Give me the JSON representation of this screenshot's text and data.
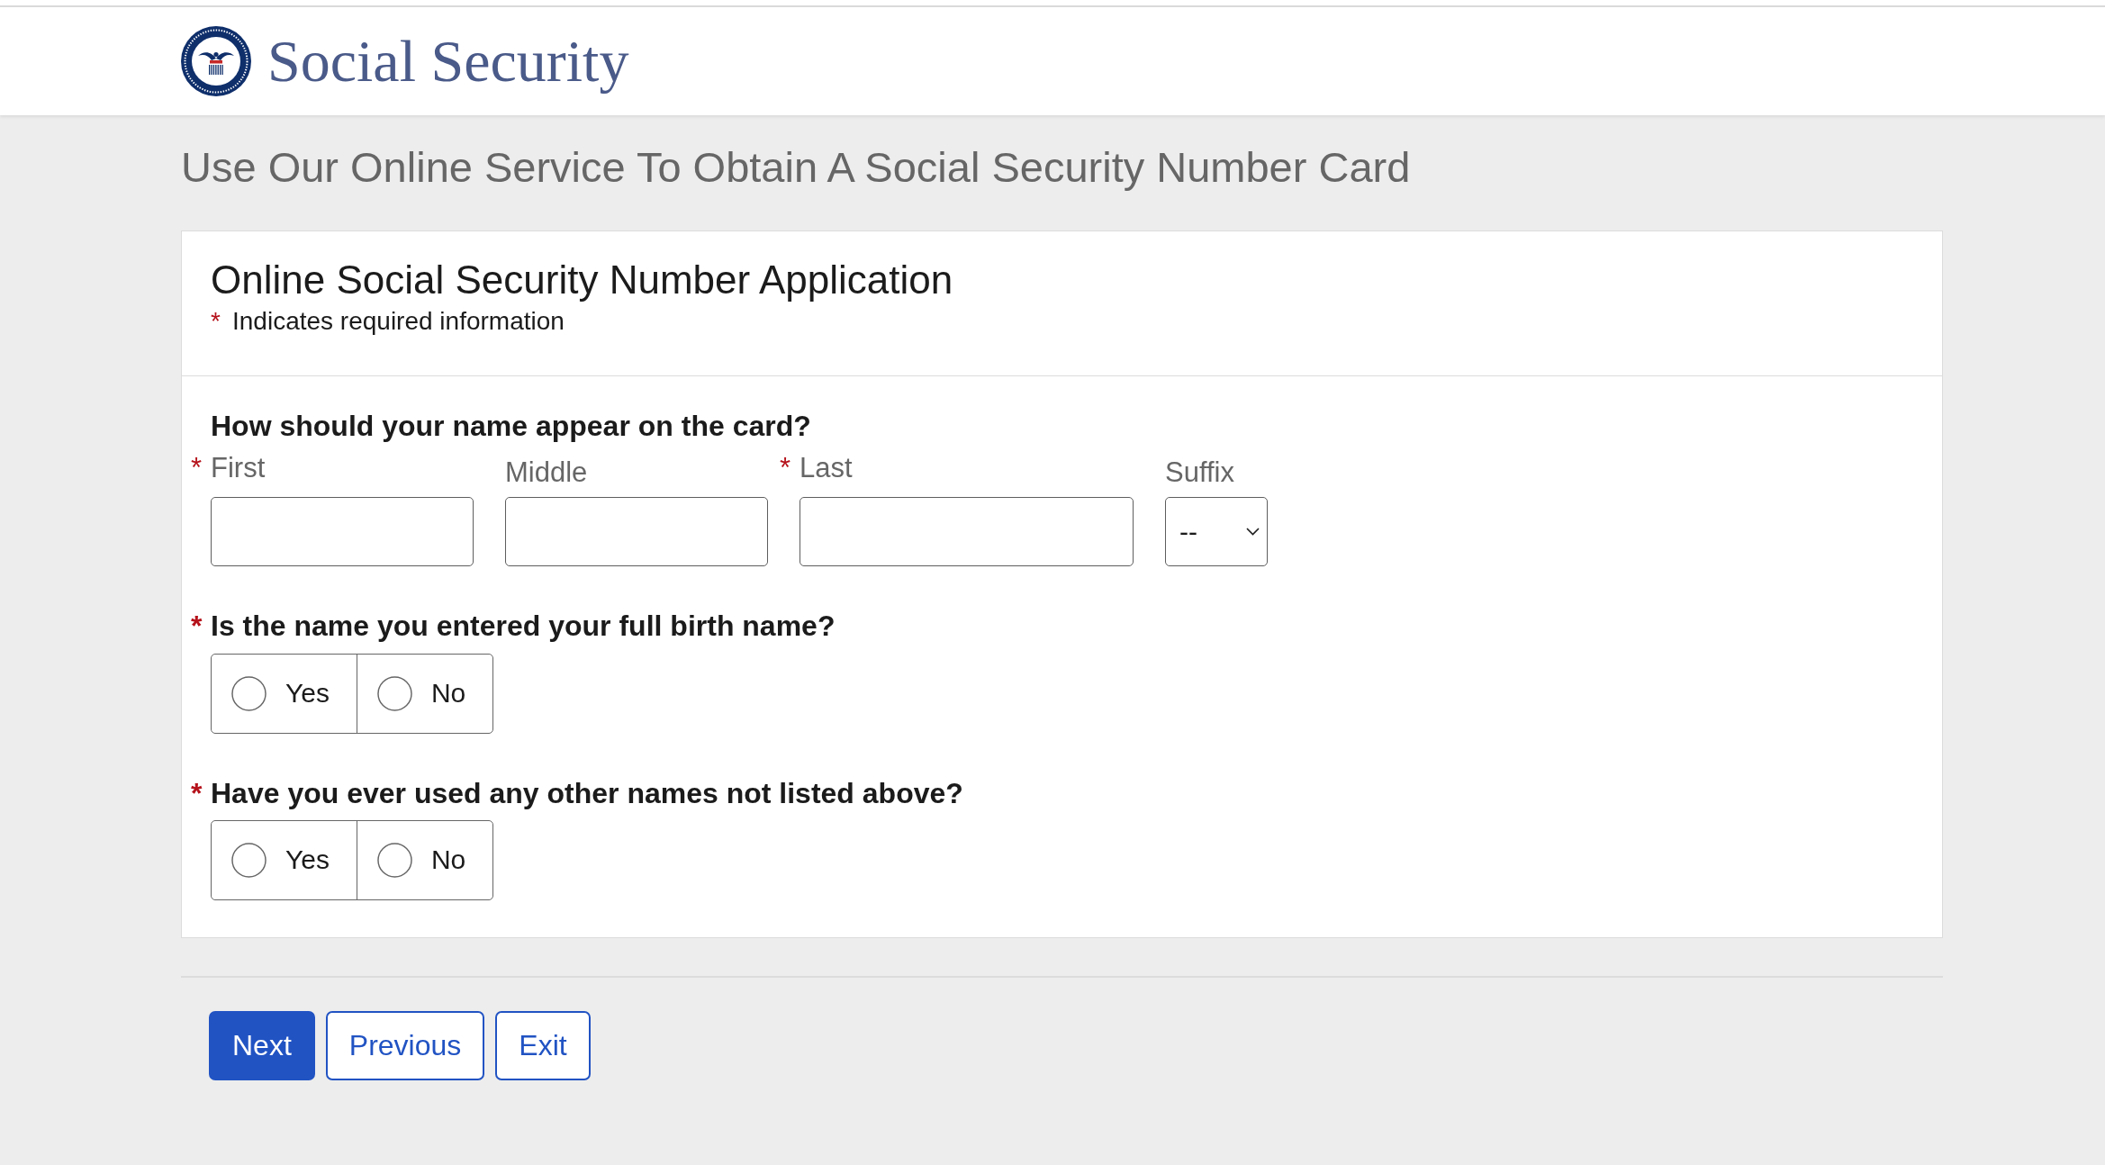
{
  "header": {
    "site_name": "Social Security"
  },
  "page_title": "Use Our Online Service To Obtain A Social Security Number Card",
  "form": {
    "title": "Online Social Security Number Application",
    "required_note": {
      "marker": "*",
      "text": "Indicates required information"
    },
    "name_question": {
      "text": "How should your name appear on the card?",
      "fields": [
        {
          "kind": "text",
          "marker": "*",
          "label": "First"
        },
        {
          "kind": "text",
          "label": "Middle"
        },
        {
          "kind": "text",
          "marker": "*",
          "label": "Last"
        },
        {
          "kind": "select",
          "label": "Suffix",
          "value": "--"
        }
      ]
    },
    "questions": [
      {
        "marker": "*",
        "text": "Is the name you entered your full birth name?",
        "options": [
          {
            "label": "Yes",
            "selected": false
          },
          {
            "label": "No",
            "selected": false
          }
        ]
      },
      {
        "marker": "*",
        "text": "Have you ever used any other names not listed above?",
        "options": [
          {
            "label": "Yes",
            "selected": false
          },
          {
            "label": "No",
            "selected": false
          }
        ]
      }
    ]
  },
  "buttons": [
    {
      "kind": "primary",
      "label": "Next"
    },
    {
      "kind": "secondary",
      "label": "Previous"
    },
    {
      "kind": "secondary",
      "label": "Exit"
    }
  ]
}
